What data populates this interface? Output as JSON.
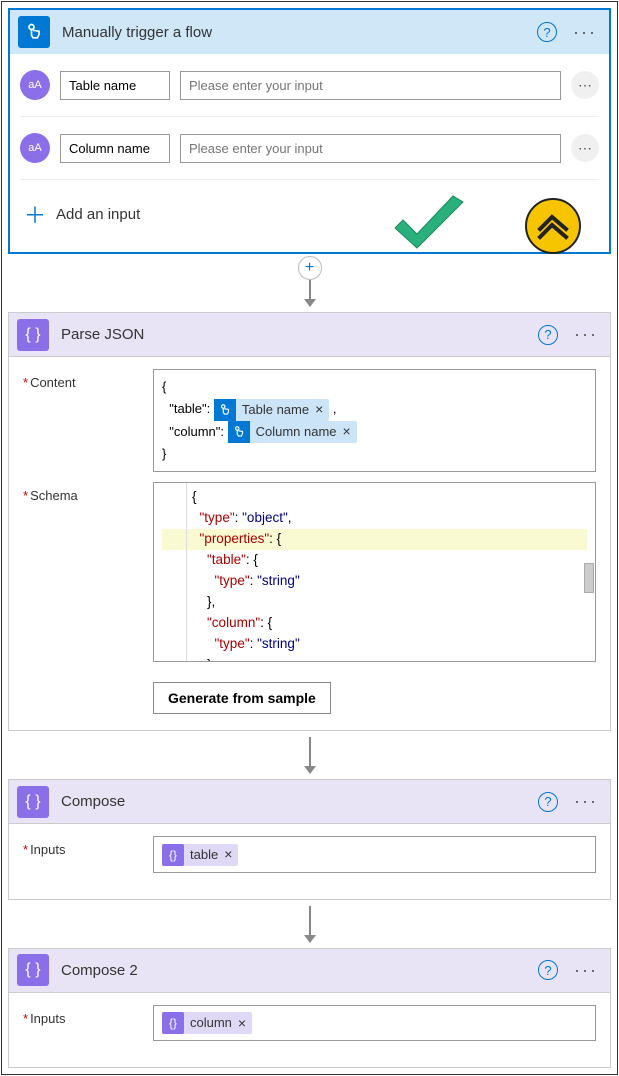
{
  "trigger": {
    "title": "Manually trigger a flow",
    "params": [
      {
        "name": "Table name",
        "placeholder": "Please enter your input"
      },
      {
        "name": "Column name",
        "placeholder": "Please enter your input"
      }
    ],
    "add_label": "Add an input"
  },
  "parse": {
    "title": "Parse JSON",
    "content_label": "Content",
    "schema_label": "Schema",
    "content_prefix1": "\"table\":",
    "content_prefix2": "\"column\":",
    "token_table": "Table name",
    "token_column": "Column name",
    "gen_button": "Generate from sample",
    "schema_lines": [
      {
        "t": "{",
        "cls": ""
      },
      {
        "t": "  \"type\": \"object\",",
        "cls": ""
      },
      {
        "t": "  \"properties\": {",
        "cls": "hl"
      },
      {
        "t": "    \"table\": {",
        "cls": ""
      },
      {
        "t": "      \"type\": \"string\"",
        "cls": ""
      },
      {
        "t": "    },",
        "cls": ""
      },
      {
        "t": "    \"column\": {",
        "cls": ""
      },
      {
        "t": "      \"type\": \"string\"",
        "cls": ""
      },
      {
        "t": "    }",
        "cls": ""
      }
    ]
  },
  "compose1": {
    "title": "Compose",
    "inputs_label": "Inputs",
    "token": "table"
  },
  "compose2": {
    "title": "Compose 2",
    "inputs_label": "Inputs",
    "token": "column"
  }
}
